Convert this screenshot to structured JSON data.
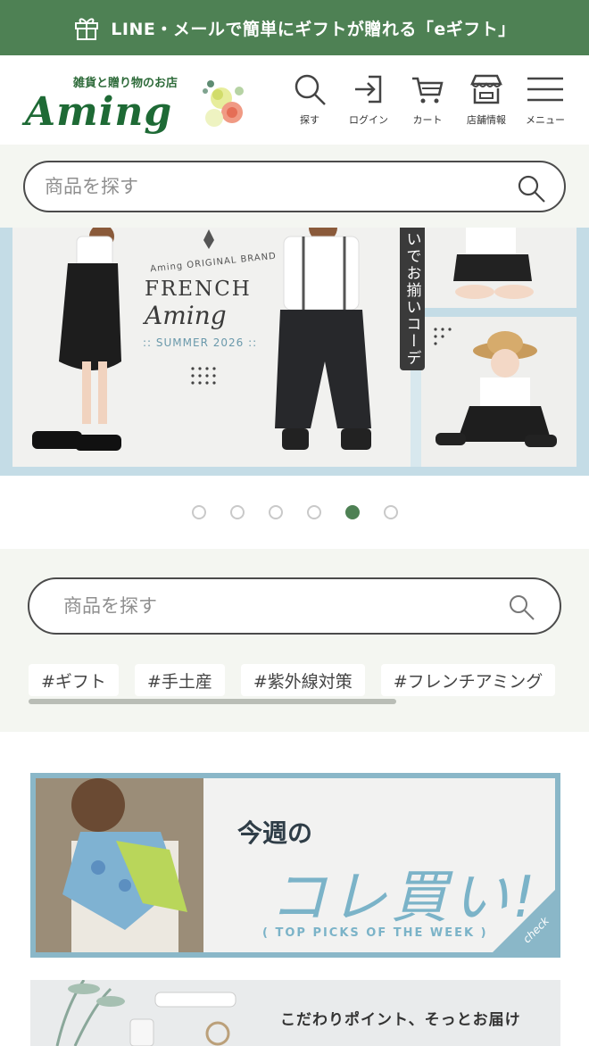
{
  "promo_bar": {
    "text": "LINE・メールで簡単にギフトが贈れる「eギフト」",
    "icon": "gift-icon"
  },
  "header": {
    "logo": {
      "tagline": "雑貨と贈り物のお店",
      "brand": "Aming"
    },
    "nav": [
      {
        "label": "探す",
        "icon": "search-icon"
      },
      {
        "label": "ログイン",
        "icon": "login-icon"
      },
      {
        "label": "カート",
        "icon": "cart-icon"
      },
      {
        "label": "店舗情報",
        "icon": "store-icon"
      },
      {
        "label": "メニュー",
        "icon": "menu-icon"
      }
    ]
  },
  "search_top": {
    "placeholder": "商品を探す"
  },
  "hero": {
    "sub_brand": "Aming ORIGINAL BRAND",
    "title_line1": "FRENCH",
    "title_line2": "Aming",
    "season": ":: SUMMER 2026 ::",
    "vertical_tab": "いでお揃いコーデ"
  },
  "carousel": {
    "total": 6,
    "active_index": 4
  },
  "search_main": {
    "placeholder": "商品を探す",
    "tags": [
      "#ギフト",
      "#手土産",
      "#紫外線対策",
      "#フレンチアミング"
    ]
  },
  "banner_week": {
    "heading": "今週の",
    "main": "コレ買い!",
    "english": "( TOP PICKS OF THE WEEK )",
    "corner": "check"
  },
  "banner_second": {
    "caption": "こだわりポイント、そっとお届け"
  },
  "colors": {
    "brand_green": "#4e8154",
    "accent_blue": "#8ab7c8",
    "band_bg": "#f4f6f1"
  }
}
